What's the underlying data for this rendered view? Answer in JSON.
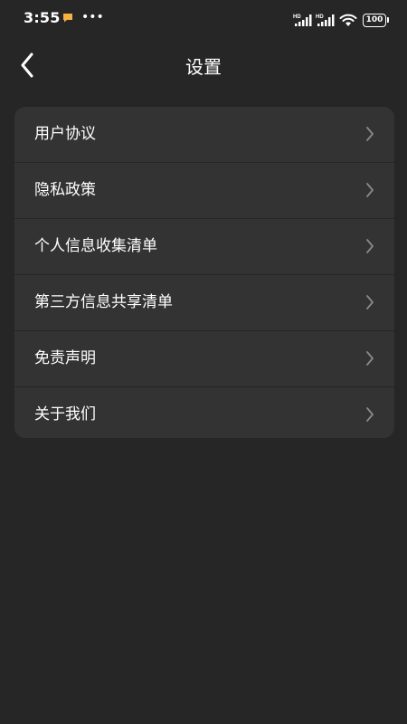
{
  "status_bar": {
    "time": "3:55",
    "signal_label_1": "HD",
    "signal_label_2": "HD",
    "battery": "100"
  },
  "header": {
    "title": "设置"
  },
  "settings": {
    "items": [
      {
        "label": "用户协议"
      },
      {
        "label": "隐私政策"
      },
      {
        "label": "个人信息收集清单"
      },
      {
        "label": "第三方信息共享清单"
      },
      {
        "label": "免责声明"
      },
      {
        "label": "关于我们"
      }
    ]
  },
  "colors": {
    "background": "#262626",
    "card": "#333334",
    "notification_accent": "#f5b142",
    "chevron": "#8a8a8a"
  }
}
